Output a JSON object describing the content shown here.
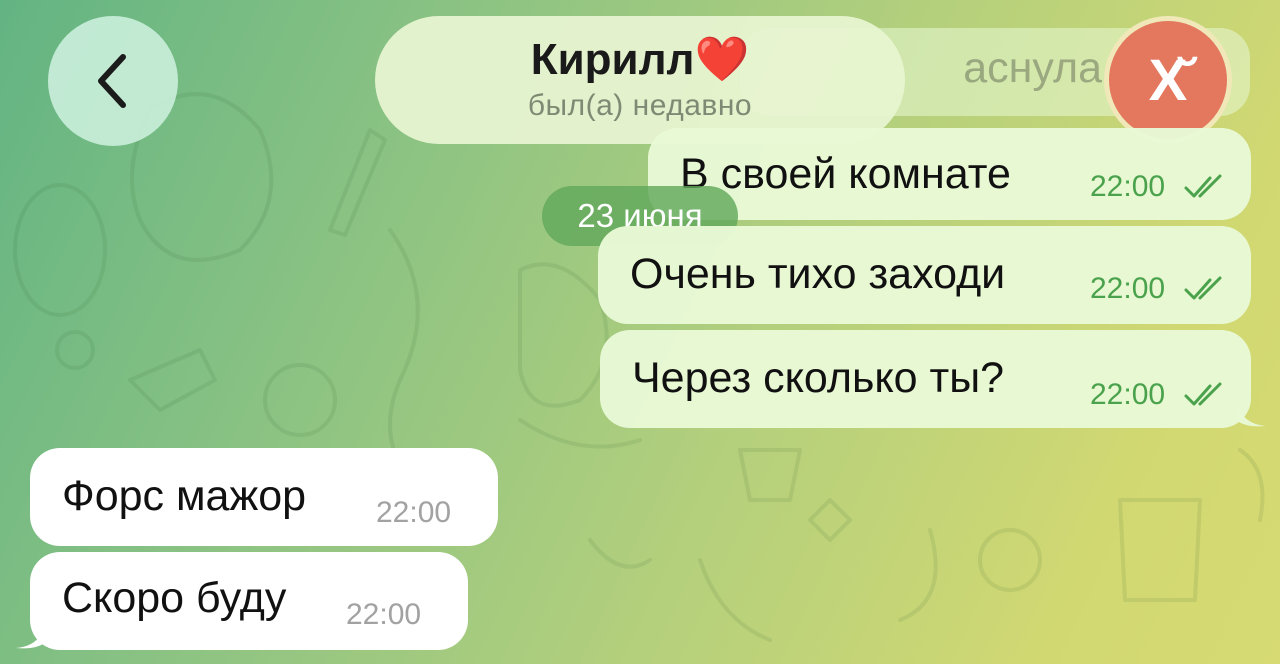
{
  "header": {
    "contact_name": "Кирилл",
    "contact_emoji": "❤️",
    "status": "был(а) недавно",
    "avatar_letter": "Х̆",
    "back_icon": "chevron-left-icon"
  },
  "date_separator": "23 июня",
  "faded_message_fragment": "аснула",
  "messages": [
    {
      "direction": "outgoing",
      "text": "В своей комнате",
      "time": "22:00",
      "read": true
    },
    {
      "direction": "outgoing",
      "text": "Очень тихо заходи",
      "time": "22:00",
      "read": true
    },
    {
      "direction": "outgoing",
      "text": "Через сколько ты?",
      "time": "22:00",
      "read": true
    },
    {
      "direction": "incoming",
      "text": "Форс мажор",
      "time": "22:00"
    },
    {
      "direction": "incoming",
      "text": "Скоро буду",
      "time": "22:00"
    }
  ],
  "colors": {
    "outgoing_bubble": "#e8f9d6",
    "incoming_bubble": "#ffffff",
    "time_outgoing": "#4aa24c",
    "time_incoming": "#a2a2a2",
    "avatar_bg": "#e3785f",
    "date_pill_bg": "#62a85c",
    "heart": "#e0252f"
  }
}
